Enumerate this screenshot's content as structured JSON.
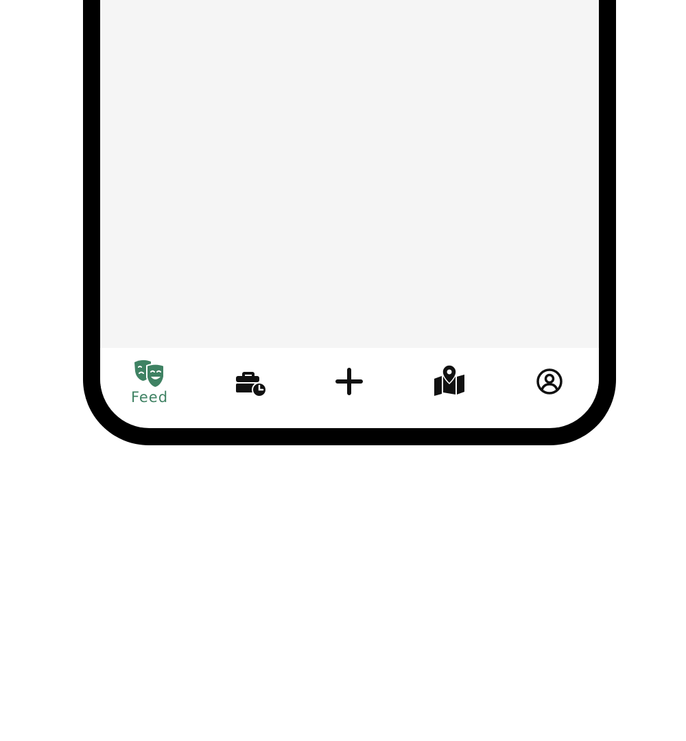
{
  "colors": {
    "background": "#ffffff",
    "frame": "#000000",
    "content_background": "#f5f5f5",
    "tab_bar_background": "#ffffff",
    "active_tab": "#3f8263",
    "inactive_tab": "#111111"
  },
  "tab_bar": {
    "active_tab": "feed",
    "tabs": [
      {
        "id": "feed",
        "label": "Feed",
        "icon": "theater-masks-icon"
      },
      {
        "id": "jobs",
        "label": "",
        "icon": "briefcase-clock-icon"
      },
      {
        "id": "add",
        "label": "",
        "icon": "plus-icon"
      },
      {
        "id": "map",
        "label": "",
        "icon": "map-pin-icon"
      },
      {
        "id": "profile",
        "label": "",
        "icon": "user-circle-icon"
      }
    ]
  }
}
